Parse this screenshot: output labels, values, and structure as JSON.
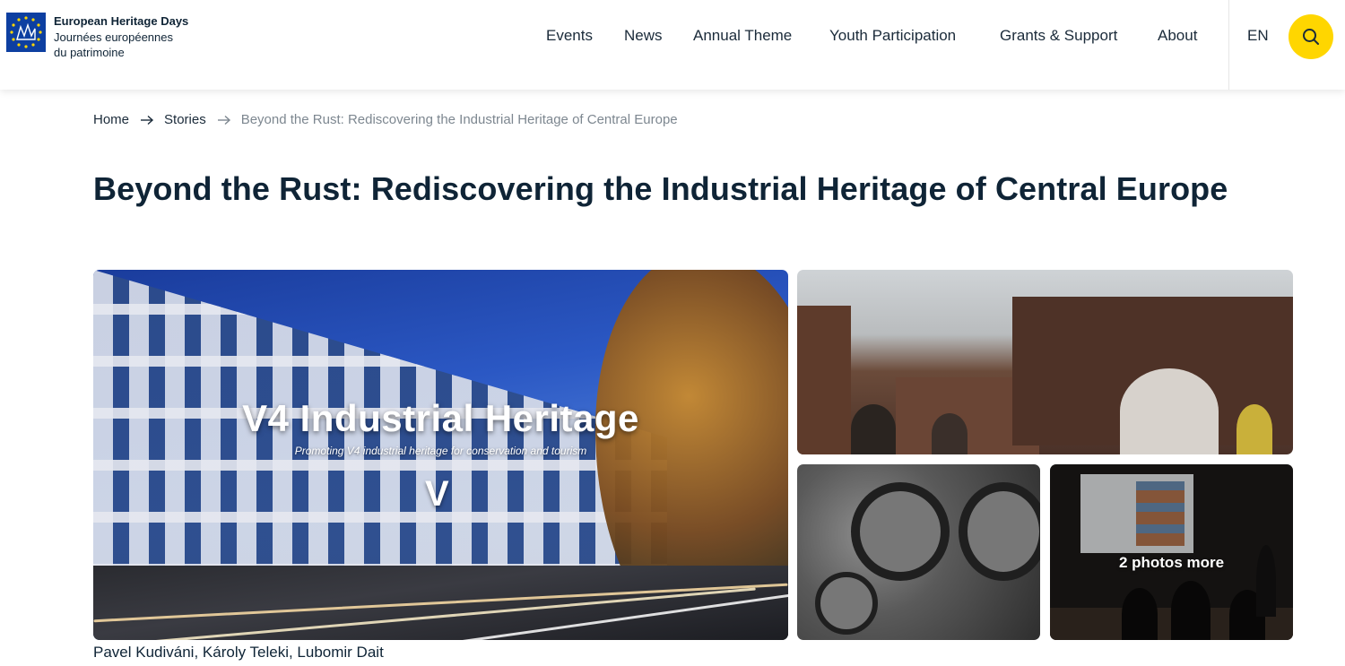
{
  "brand": {
    "line1": "European Heritage Days",
    "line2": "Journées européennes",
    "line3": "du patrimoine",
    "logo_icon": "eu-heritage-logo-icon",
    "logo_color": "#0d3fa1"
  },
  "nav": {
    "items": [
      {
        "label": "Events"
      },
      {
        "label": "News"
      },
      {
        "label": "Annual Theme"
      },
      {
        "label": "Youth Participation"
      },
      {
        "label": "Grants & Support"
      },
      {
        "label": "About"
      }
    ],
    "language": "EN",
    "search_icon": "search-icon",
    "search_color": "#ffd600"
  },
  "breadcrumb": {
    "items": [
      "Home",
      "Stories",
      "Beyond the Rust: Rediscovering the Industrial Heritage of Central Europe"
    ],
    "separator_icon": "arrow-right-icon"
  },
  "page": {
    "title": "Beyond the Rust: Rediscovering the Industrial Heritage of Central Europe"
  },
  "gallery": {
    "main": {
      "overlay_title": "V4 Industrial Heritage",
      "overlay_subtitle": "Promoting V4 industrial heritage for conservation and tourism",
      "overlay_mark": "V"
    },
    "more_label": "2 photos more",
    "credits": "Pavel Kudiváni, Károly Teleki, Lubomir Dait"
  }
}
